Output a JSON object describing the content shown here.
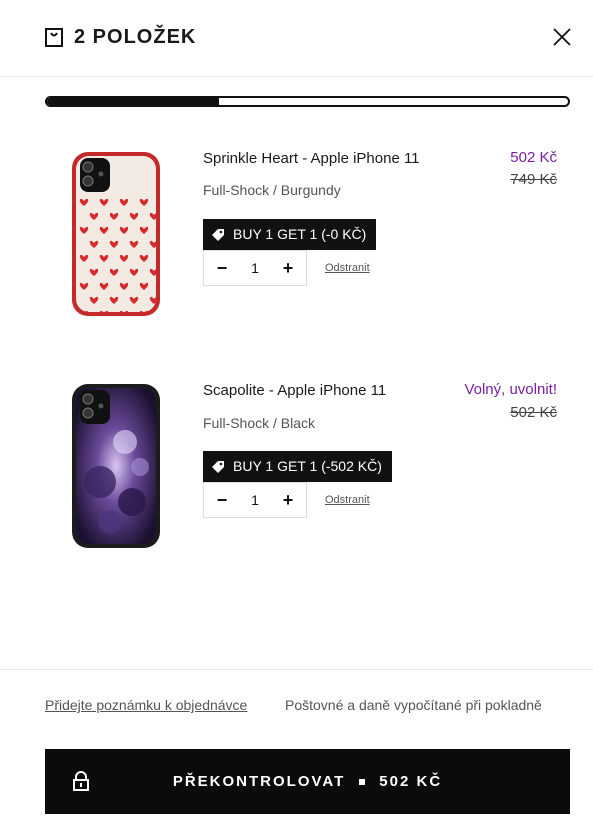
{
  "header": {
    "title": "2 POLOŽEK",
    "bag_icon": "shopping-bag-icon",
    "close_icon": "close-icon"
  },
  "progress": {
    "value": 0.33
  },
  "items": [
    {
      "name": "Sprinkle Heart - Apple iPhone 11",
      "variant": "Full-Shock / Burgundy",
      "price_sale": "502 Kč",
      "price_old": "749 Kč",
      "promo": "BUY 1 GET 1 (-0 KČ)",
      "quantity": "1",
      "remove_label": "Odstranit"
    },
    {
      "name": "Scapolite - Apple iPhone 11",
      "variant": "Full-Shock / Black",
      "price_sale": "Volný, uvolnit!",
      "price_old": "502 Kč",
      "promo": "BUY 1 GET 1 (-502 KČ)",
      "quantity": "1",
      "remove_label": "Odstranit"
    }
  ],
  "footer": {
    "note_link": "Přidejte poznámku k objednávce",
    "shipping_note": "Poštovné a daně vypočítané při pokladně",
    "checkout_label": "PŘEKONTROLOVAT",
    "checkout_total": "502 KČ"
  },
  "colors": {
    "accent_purple": "#7a1fa2",
    "button_black": "#0b0b0b",
    "case_red": "#c42a2a"
  }
}
